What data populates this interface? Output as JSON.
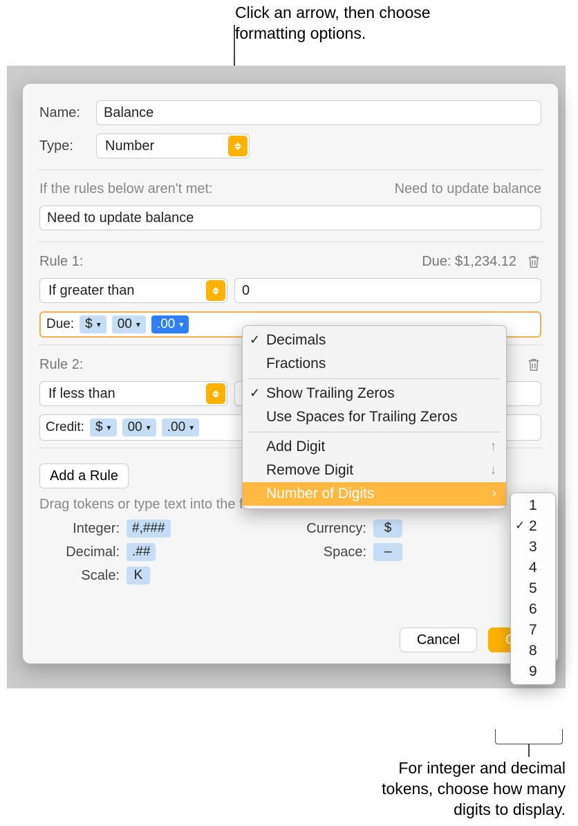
{
  "callouts": {
    "top": "Click an arrow, then choose formatting options.",
    "bottom": "For integer and decimal tokens, choose how many digits to display."
  },
  "form": {
    "name_label": "Name:",
    "name_value": "Balance",
    "type_label": "Type:",
    "type_value": "Number",
    "fallback_label": "If the rules below aren't met:",
    "fallback_preview": "Need to update balance",
    "fallback_value": "Need to update balance"
  },
  "rules": [
    {
      "title": "Rule 1:",
      "preview": "Due: $1,234.12",
      "condition": "If greater than",
      "value": "0",
      "prefix": "Due:",
      "tokens": [
        "$",
        "00",
        ".00"
      ]
    },
    {
      "title": "Rule 2:",
      "preview": "",
      "condition": "If less than",
      "value": "",
      "prefix": "Credit:",
      "tokens": [
        "$",
        "00",
        ".00"
      ]
    }
  ],
  "add_rule": "Add a Rule",
  "drag_hint": "Drag tokens or type text into the field above:",
  "token_library": {
    "integer_label": "Integer:",
    "integer_token": "#,###",
    "decimal_label": "Decimal:",
    "decimal_token": ".##",
    "scale_label": "Scale:",
    "scale_token": "K",
    "currency_label": "Currency:",
    "currency_token": "$",
    "space_label": "Space:",
    "space_token": "–"
  },
  "buttons": {
    "cancel": "Cancel",
    "ok": "OK"
  },
  "menu": {
    "decimals": "Decimals",
    "fractions": "Fractions",
    "show_trailing": "Show Trailing Zeros",
    "use_spaces": "Use Spaces for Trailing Zeros",
    "add_digit": "Add Digit",
    "remove_digit": "Remove Digit",
    "num_digits": "Number of Digits"
  },
  "digits_submenu": {
    "options": [
      "1",
      "2",
      "3",
      "4",
      "5",
      "6",
      "7",
      "8",
      "9"
    ],
    "selected": "2"
  }
}
